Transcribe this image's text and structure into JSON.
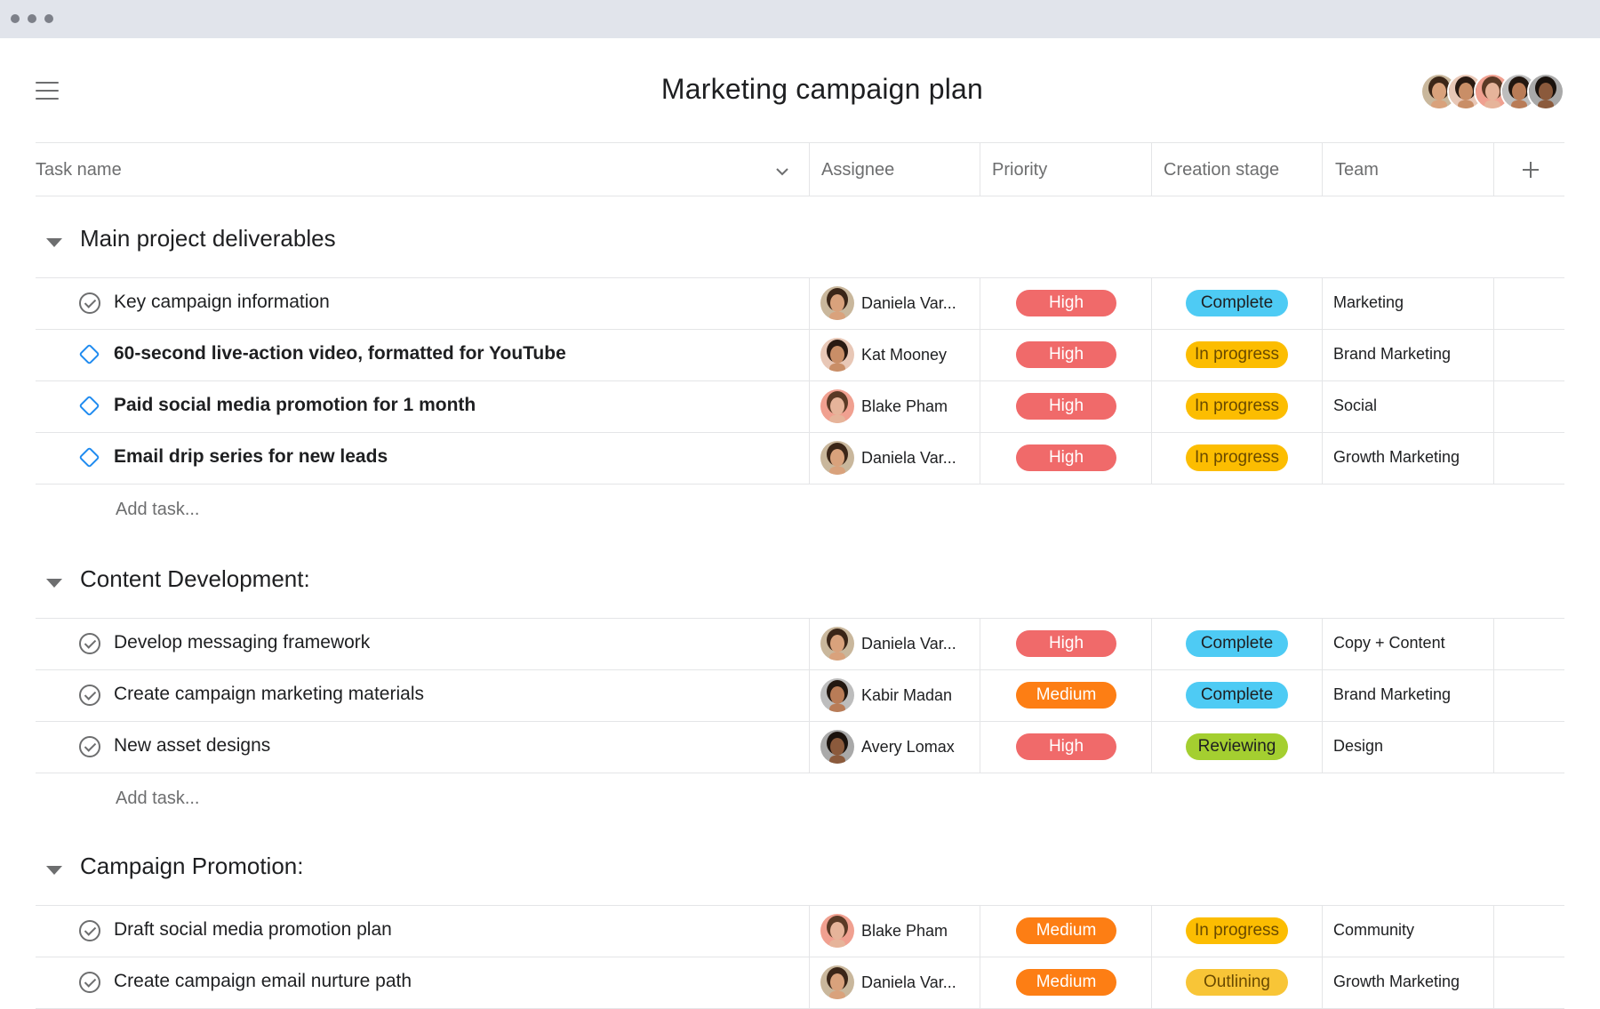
{
  "page": {
    "title": "Marketing campaign plan",
    "members": [
      {
        "name": "Daniela Var...",
        "skin": "#d9a27c",
        "hair": "#3b2618",
        "bg": "#c9b79c"
      },
      {
        "name": "Kat Mooney",
        "skin": "#c98e67",
        "hair": "#2a1a12",
        "bg": "#e8c7b6"
      },
      {
        "name": "Blake Pham",
        "skin": "#e6b49a",
        "hair": "#5a3a26",
        "bg": "#f0a090"
      },
      {
        "name": "Kabir Madan",
        "skin": "#b97c57",
        "hair": "#221710",
        "bg": "#bdbdbd"
      },
      {
        "name": "Avery Lomax",
        "skin": "#8b5a3c",
        "hair": "#1a120d",
        "bg": "#a9a9a9"
      }
    ]
  },
  "columns": {
    "task_name": "Task name",
    "assignee": "Assignee",
    "priority": "Priority",
    "creation_stage": "Creation stage",
    "team": "Team"
  },
  "colors": {
    "High": "#f06a6a",
    "Medium": "#fd7e14",
    "Complete": "#4ecbf4",
    "In progress": "#fcbd01",
    "Reviewing": "#a4cf30",
    "Outlining": "#f8c537"
  },
  "sections": [
    {
      "title": "Main project deliverables",
      "add_task": "Add task...",
      "tasks": [
        {
          "name": "Key campaign information",
          "bold": false,
          "icon": "check-circle-icon",
          "assignee": "Daniela Var...",
          "avatar": 0,
          "priority": "High",
          "stage": "Complete",
          "team": "Marketing"
        },
        {
          "name": "60-second live-action video, formatted for YouTube",
          "bold": true,
          "icon": "milestone-diamond-icon",
          "assignee": "Kat Mooney",
          "avatar": 1,
          "priority": "High",
          "stage": "In progress",
          "team": "Brand Marketing"
        },
        {
          "name": "Paid social media promotion for 1 month",
          "bold": true,
          "icon": "milestone-diamond-icon",
          "assignee": "Blake Pham",
          "avatar": 2,
          "priority": "High",
          "stage": "In progress",
          "team": "Social"
        },
        {
          "name": "Email drip series for new leads",
          "bold": true,
          "icon": "milestone-diamond-icon",
          "assignee": "Daniela Var...",
          "avatar": 0,
          "priority": "High",
          "stage": "In progress",
          "team": "Growth Marketing"
        }
      ]
    },
    {
      "title": "Content Development:",
      "add_task": "Add task...",
      "tasks": [
        {
          "name": "Develop messaging framework",
          "bold": false,
          "icon": "check-circle-icon",
          "assignee": "Daniela Var...",
          "avatar": 0,
          "priority": "High",
          "stage": "Complete",
          "team": "Copy + Content"
        },
        {
          "name": "Create campaign marketing materials",
          "bold": false,
          "icon": "check-circle-icon",
          "assignee": "Kabir Madan",
          "avatar": 3,
          "priority": "Medium",
          "stage": "Complete",
          "team": "Brand Marketing"
        },
        {
          "name": "New asset designs",
          "bold": false,
          "icon": "check-circle-icon",
          "assignee": "Avery Lomax",
          "avatar": 4,
          "priority": "High",
          "stage": "Reviewing",
          "team": "Design"
        }
      ]
    },
    {
      "title": "Campaign Promotion:",
      "add_task": "",
      "tasks": [
        {
          "name": "Draft social media promotion plan",
          "bold": false,
          "icon": "check-circle-icon",
          "assignee": "Blake Pham",
          "avatar": 2,
          "priority": "Medium",
          "stage": "In progress",
          "team": "Community"
        },
        {
          "name": "Create campaign email nurture path",
          "bold": false,
          "icon": "check-circle-icon",
          "assignee": "Daniela Var...",
          "avatar": 0,
          "priority": "Medium",
          "stage": "Outlining",
          "team": "Growth Marketing"
        }
      ]
    }
  ]
}
